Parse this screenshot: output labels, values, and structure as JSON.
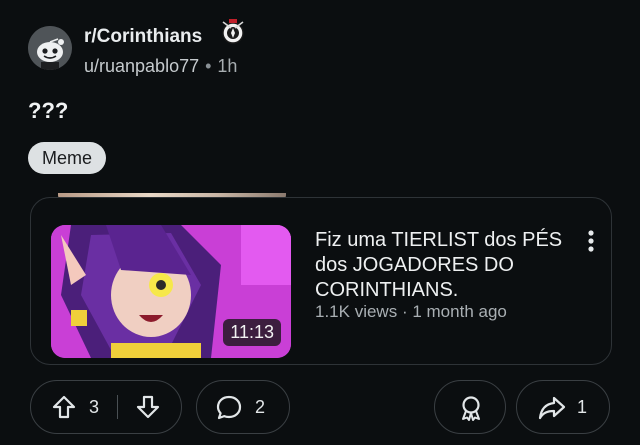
{
  "post": {
    "subreddit": "r/Corinthians",
    "author": "u/ruanpablo77",
    "separator": "•",
    "time": "1h",
    "title": "???",
    "flair": "Meme"
  },
  "embed": {
    "video_title": "Fiz uma TIERLIST dos PÉS dos JOGADORES DO CORINTHIANS.",
    "views": "1.1K views",
    "meta_separator": "·",
    "age": "1 month ago",
    "duration": "11:13"
  },
  "actions": {
    "upvotes": "3",
    "comments": "2",
    "shares": "1"
  },
  "colors": {
    "background": "#0b0e10",
    "flair_bg": "#dde1e3",
    "pill_border": "#3a3f43",
    "thumb_magenta": "#c93fd6"
  },
  "icons": {
    "avatar": "snoo-avatar-icon",
    "subreddit_badge": "corinthians-crest-icon",
    "more": "vertical-dots-icon",
    "upvote": "upvote-arrow-icon",
    "downvote": "downvote-arrow-icon",
    "comment": "comment-bubble-icon",
    "award": "award-icon",
    "share": "share-arrow-icon"
  }
}
